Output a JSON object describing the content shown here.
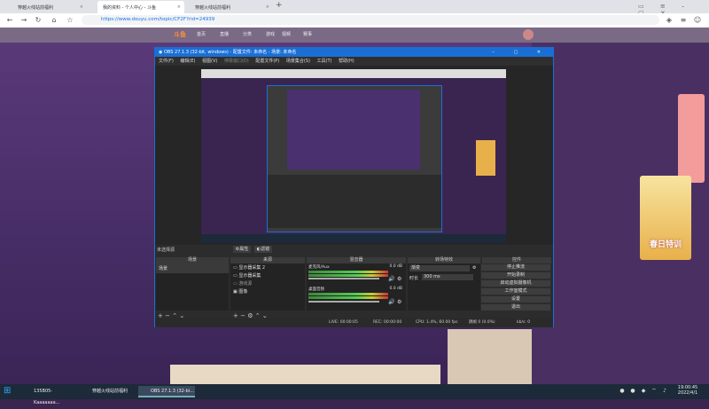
{
  "browser": {
    "tabs": [
      {
        "title": "穿越火线站前福利",
        "active": false
      },
      {
        "title": "我的资料 - 个人中心 - 斗鱼",
        "active": true
      },
      {
        "title": "穿越火线站前福利",
        "active": false
      }
    ],
    "new_tab": "+",
    "url": "https://www.douyu.com/topic/CF2F?rid=24939"
  },
  "site": {
    "logo": "斗鱼",
    "nav": [
      "首页",
      "直播",
      "分类",
      "游戏",
      "视频",
      "赛事"
    ]
  },
  "promo": {
    "text": "春日特训"
  },
  "obs": {
    "title": "OBS 27.1.3 (32-bit, windows) - 配置文件: 未命名 - 场景: 未命名",
    "menu": [
      "文件(F)",
      "编辑(E)",
      "视图(V)",
      "停靠窗口(D)",
      "配置文件(P)",
      "场景集合(S)",
      "工具(T)",
      "帮助(H)"
    ],
    "no_source": "未选择源",
    "properties_btn": "属性",
    "filters_btn": "滤镜",
    "docks": {
      "scenes": {
        "header": "场景",
        "items": [
          "场景"
        ]
      },
      "sources": {
        "header": "来源",
        "items": [
          "显示器采集 2",
          "显示器采集",
          "游戏源",
          "图像"
        ]
      },
      "mixer": {
        "header": "混音器",
        "channels": [
          {
            "name": "麦克风/Aux",
            "db": "0.0 dB"
          },
          {
            "name": "桌面音频",
            "db": "0.0 dB"
          }
        ]
      },
      "transitions": {
        "header": "转场特效",
        "type": "渐变",
        "duration_label": "时长",
        "duration": "300 ms"
      },
      "controls": {
        "header": "控件",
        "buttons": [
          "停止推流",
          "开始录制",
          "启动虚拟摄像机",
          "工作室模式",
          "设置",
          "退出"
        ]
      }
    },
    "status": {
      "live": "LIVE: 00:00:05",
      "rec": "REC: 00:00:00",
      "cpu": "CPU: 1.4%, 60.00 fps",
      "kbps": "kb/s: 0",
      "dropped": "跳帧 0 (0.0%)"
    }
  },
  "taskbar": {
    "tasks": [
      {
        "label": "135B05-Kaaaaaaa...",
        "active": false
      },
      {
        "label": "穿越火线站前福利",
        "active": false
      },
      {
        "label": "OBS 27.1.3 (32-bi...",
        "active": true
      }
    ],
    "time": "19:00:45",
    "date": "2022/4/1"
  },
  "colors": {
    "obs_accent": "#1a6fd6",
    "page_bg": "#4a2f6a",
    "taskbar": "#1c2a3a"
  }
}
